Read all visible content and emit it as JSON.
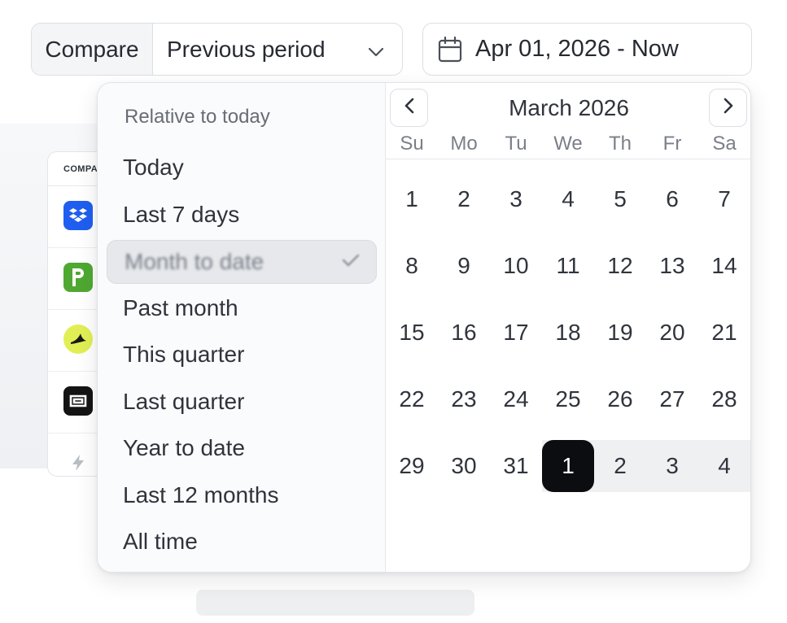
{
  "compare": {
    "label": "Compare",
    "value": "Previous period"
  },
  "date_range": {
    "value": "Apr 01, 2026 - Now"
  },
  "background": {
    "table_header": "COMPA"
  },
  "presets": {
    "title": "Relative to today",
    "items": [
      {
        "label": "Today"
      },
      {
        "label": "Last 7 days"
      },
      {
        "label": "Month to date",
        "selected": true
      },
      {
        "label": "Past month"
      },
      {
        "label": "This quarter"
      },
      {
        "label": "Last quarter"
      },
      {
        "label": "Year to date"
      },
      {
        "label": "Last 12 months"
      },
      {
        "label": "All time"
      }
    ]
  },
  "calendar": {
    "month_label": "March 2026",
    "weekdays": [
      "Su",
      "Mo",
      "Tu",
      "We",
      "Th",
      "Fr",
      "Sa"
    ],
    "weeks": [
      [
        "1",
        "2",
        "3",
        "4",
        "5",
        "6",
        "7"
      ],
      [
        "8",
        "9",
        "10",
        "11",
        "12",
        "13",
        "14"
      ],
      [
        "15",
        "16",
        "17",
        "18",
        "19",
        "20",
        "21"
      ],
      [
        "22",
        "23",
        "24",
        "25",
        "26",
        "27",
        "28"
      ],
      [
        "29",
        "30",
        "31",
        "1",
        "2",
        "3",
        "4"
      ]
    ],
    "selected_day": "1"
  },
  "colors": {
    "selected_day_bg": "#0c0d10",
    "range_band": "#eef0f2",
    "border": "#dcdfe4"
  }
}
